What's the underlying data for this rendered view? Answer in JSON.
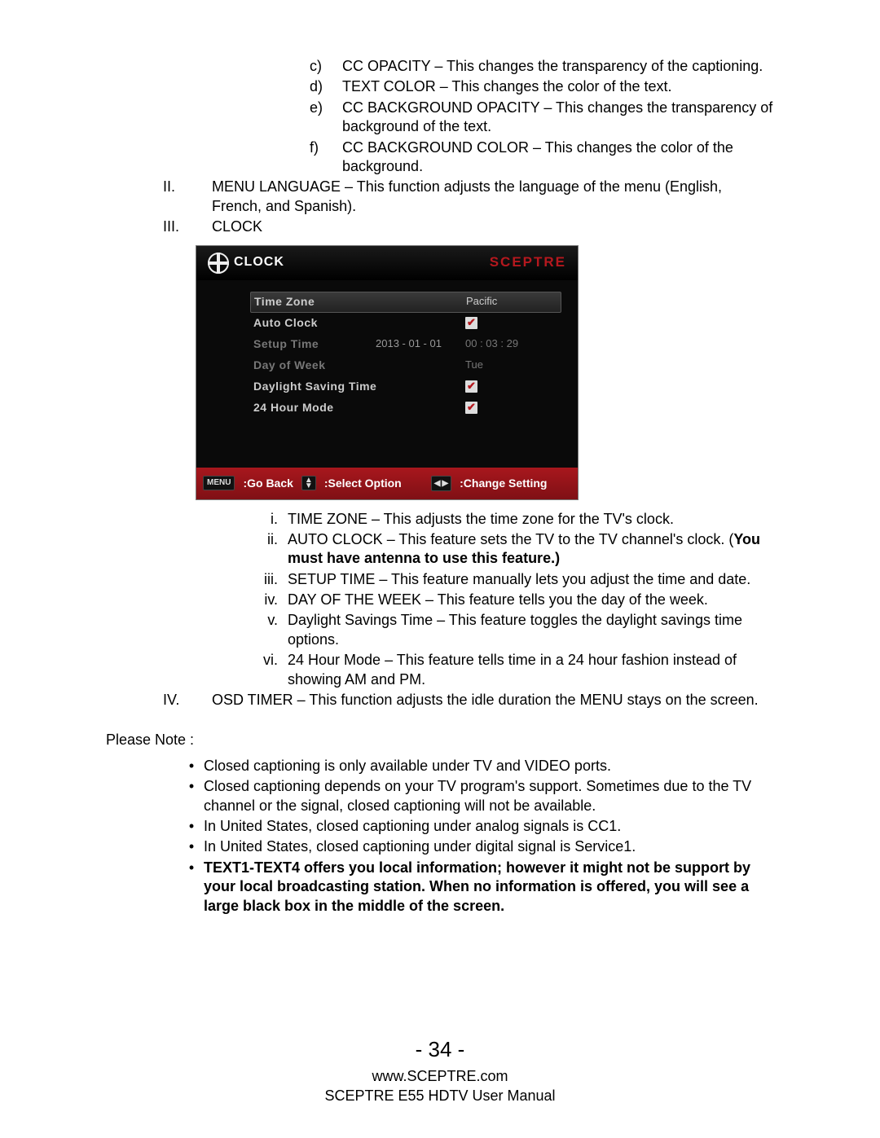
{
  "list_c": {
    "c": {
      "m": "c)",
      "t": "CC OPACITY – This changes the transparency of the captioning."
    },
    "d": {
      "m": "d)",
      "t": "TEXT COLOR – This changes the color of the text."
    },
    "e": {
      "m": "e)",
      "t": "CC BACKGROUND OPACITY – This changes the transparency of background of the text."
    },
    "f": {
      "m": "f)",
      "t": "CC BACKGROUND COLOR – This changes the color of the background."
    }
  },
  "roman": {
    "II": {
      "m": "II.",
      "t": "MENU LANGUAGE – This function adjusts the language of the menu (English, French, and Spanish)."
    },
    "III": {
      "m": "III.",
      "t": "CLOCK"
    },
    "IV": {
      "m": "IV.",
      "t": "OSD TIMER – This function adjusts the idle duration the MENU stays on the screen."
    }
  },
  "osd": {
    "title": "CLOCK",
    "brand": "SCEPTRE",
    "rows": {
      "tz": {
        "label": "Time Zone",
        "val": "Pacific"
      },
      "ac": {
        "label": "Auto Clock"
      },
      "st": {
        "label": "Setup Time",
        "mid": "2013 - 01 - 01",
        "val": "00 : 03 : 29"
      },
      "dow": {
        "label": "Day of Week",
        "val": "Tue"
      },
      "dst": {
        "label": "Daylight Saving Time"
      },
      "h24": {
        "label": "24 Hour Mode"
      }
    },
    "footer": {
      "menu": "MENU",
      "goback": ":Go Back",
      "select": ":Select Option",
      "change": ":Change Setting"
    }
  },
  "iii_list": {
    "i": {
      "m": "i.",
      "t": "TIME ZONE – This adjusts the time zone for the TV's clock."
    },
    "ii": {
      "m": "ii.",
      "t1": "AUTO CLOCK – This feature sets the TV to the TV channel's clock. (",
      "bold": "You must have antenna to use this feature.)"
    },
    "iii": {
      "m": "iii.",
      "t": "SETUP TIME – This feature manually lets you adjust the time and date."
    },
    "iv": {
      "m": "iv.",
      "t": "DAY OF THE WEEK – This feature tells you the day of the week."
    },
    "v": {
      "m": "v.",
      "t": "Daylight Savings Time – This feature toggles the daylight savings time options."
    },
    "vi": {
      "m": "vi.",
      "t": "24 Hour Mode – This feature tells time in a 24 hour fashion instead of showing AM and PM."
    }
  },
  "please_note": "Please Note :",
  "bullets": {
    "b1": "Closed captioning is only available under TV and VIDEO ports.",
    "b2": "Closed captioning depends on your TV program's support. Sometimes due to the TV channel or the signal, closed captioning will not be available.",
    "b3": "In United States, closed captioning under analog signals is CC1.",
    "b4": "In United States, closed captioning under digital signal is Service1.",
    "b5": "TEXT1-TEXT4 offers you local information; however it might not be support by your local broadcasting station. When no information is offered, you will see a large black box in the middle of the screen."
  },
  "footer": {
    "page": "- 34 -",
    "url": "www.SCEPTRE.com",
    "manual": "SCEPTRE E55 HDTV User Manual"
  }
}
